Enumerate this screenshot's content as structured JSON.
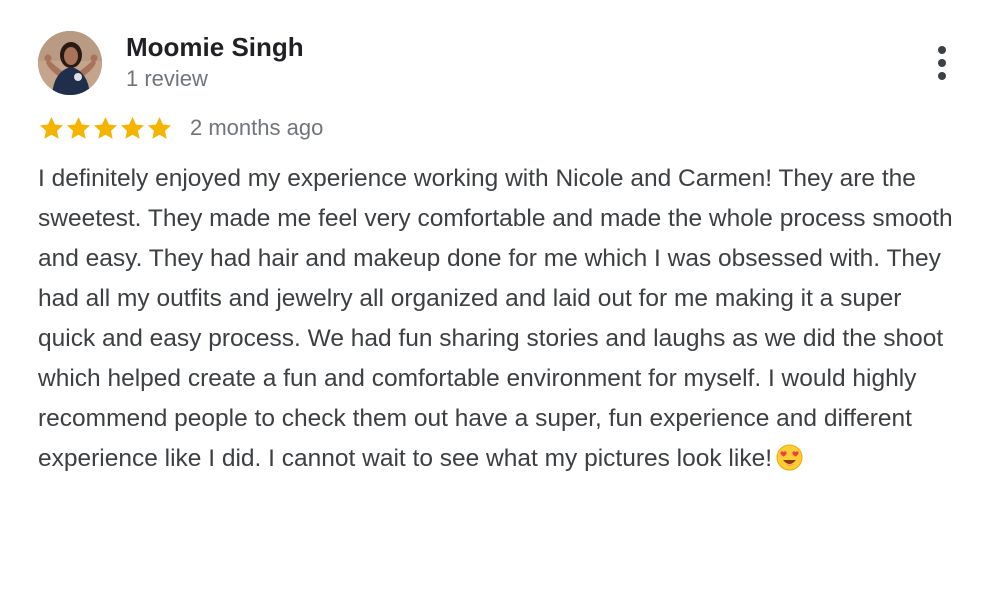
{
  "reviewer": {
    "name": "Moomie Singh",
    "review_count": "1 review"
  },
  "rating": {
    "stars": 5,
    "max": 5,
    "color": "#f4b400"
  },
  "time": "2 months ago",
  "review": {
    "text": "I definitely enjoyed my experience working with Nicole and Carmen! They are the sweetest. They made me feel very comfortable and made the whole process smooth and easy. They had hair and makeup done for me which I was obsessed with. They had all my outfits and jewelry all organized and laid out for me making it a super quick and easy process. We had fun sharing stories and laughs as we did the shoot which helped create a fun and comfortable environment for myself. I would highly recommend people to check them out have a super, fun experience and different experience like I did. I cannot wait to see what my pictures look like!",
    "emoji": "heart-eyes-emoji"
  },
  "icons": {
    "more": "more-vert-icon",
    "star": "star-icon",
    "avatar": "profile-photo"
  }
}
